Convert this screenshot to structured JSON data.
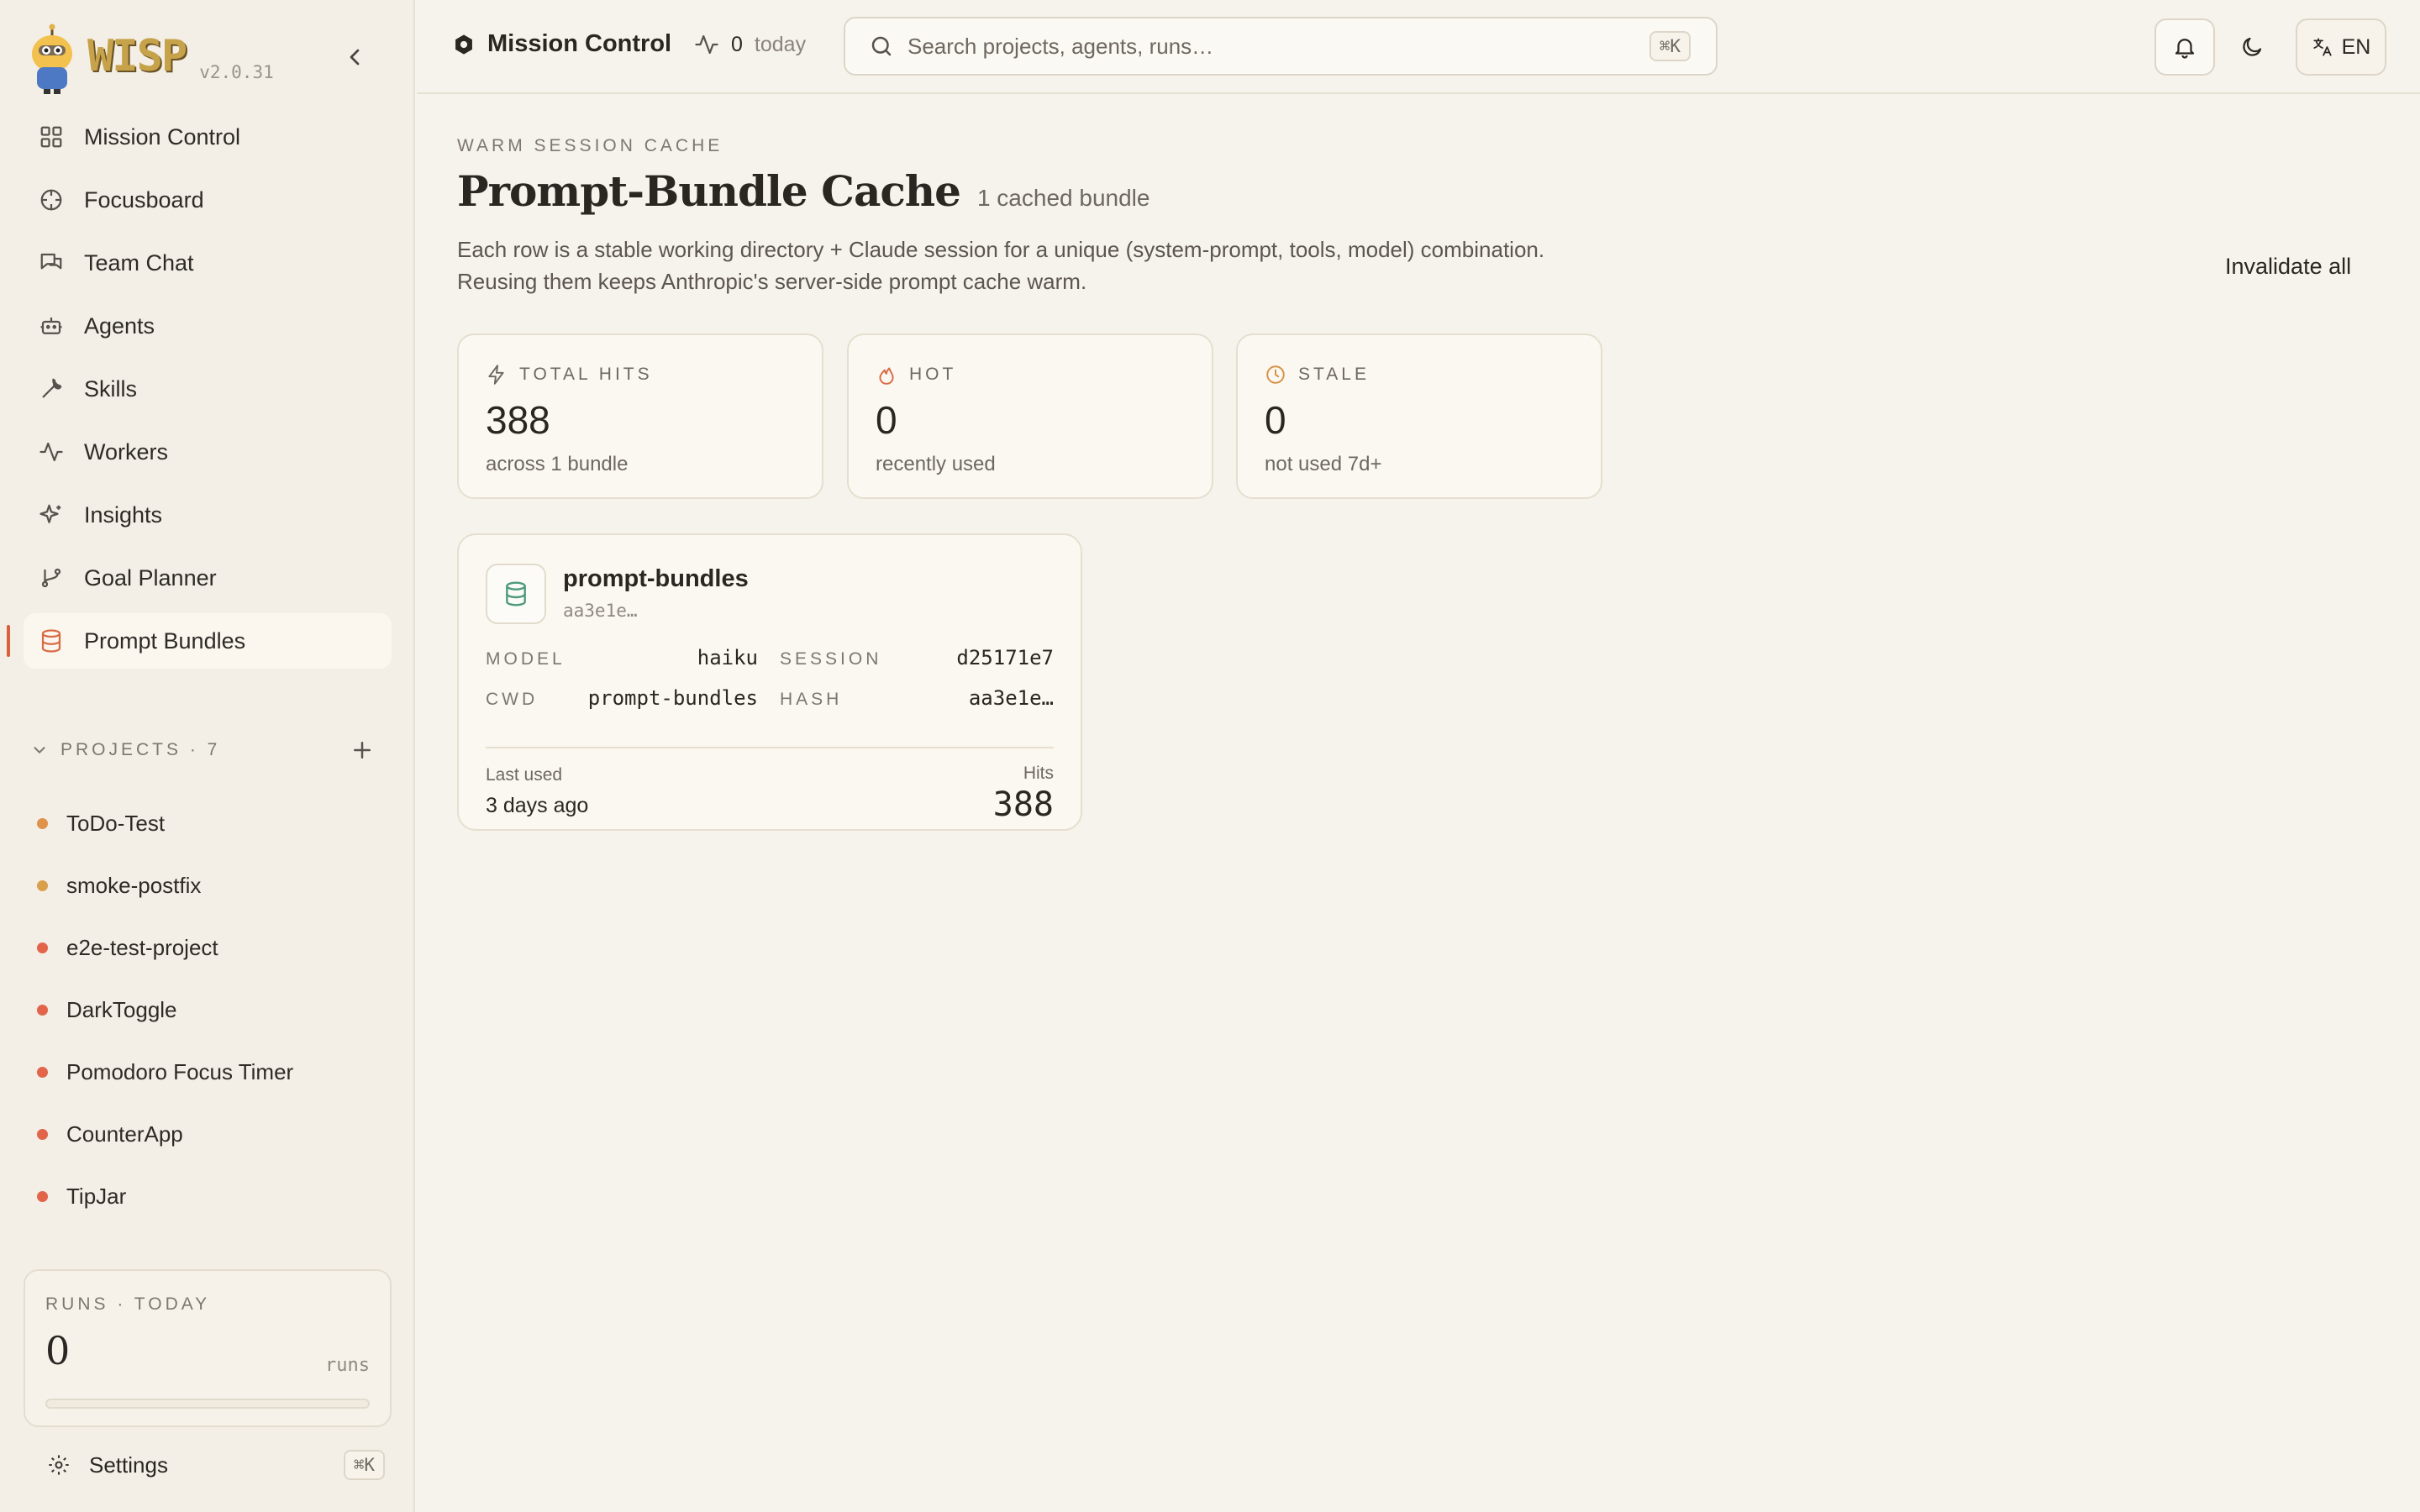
{
  "brand": {
    "name": "WISP",
    "version": "v2.0.31"
  },
  "nav": [
    {
      "label": "Mission Control",
      "icon": "grid-icon"
    },
    {
      "label": "Focusboard",
      "icon": "crosshair-icon"
    },
    {
      "label": "Team Chat",
      "icon": "chat-icon"
    },
    {
      "label": "Agents",
      "icon": "robot-icon"
    },
    {
      "label": "Skills",
      "icon": "wrench-icon"
    },
    {
      "label": "Workers",
      "icon": "activity-icon"
    },
    {
      "label": "Insights",
      "icon": "sparkles-icon"
    },
    {
      "label": "Goal Planner",
      "icon": "git-branch-icon"
    },
    {
      "label": "Prompt Bundles",
      "icon": "database-icon",
      "active": true
    }
  ],
  "projects": {
    "label": "PROJECTS · 7",
    "items": [
      {
        "name": "ToDo-Test",
        "color": "#e0914a"
      },
      {
        "name": "smoke-postfix",
        "color": "#d9a04c"
      },
      {
        "name": "e2e-test-project",
        "color": "#e2654a"
      },
      {
        "name": "DarkToggle",
        "color": "#e2654a"
      },
      {
        "name": "Pomodoro Focus Timer",
        "color": "#e2654a"
      },
      {
        "name": "CounterApp",
        "color": "#e2654a"
      },
      {
        "name": "TipJar",
        "color": "#e2654a"
      }
    ]
  },
  "runs": {
    "label": "RUNS · TODAY",
    "count": "0",
    "unit": "runs",
    "progress": 0
  },
  "settings": {
    "label": "Settings",
    "shortcut": "⌘K"
  },
  "topbar": {
    "title": "Mission Control",
    "activity_count": "0",
    "activity_label": "today",
    "search_placeholder": "Search projects, agents, runs…",
    "search_shortcut": "⌘K",
    "lang": "EN"
  },
  "page": {
    "eyebrow": "WARM SESSION CACHE",
    "title": "Prompt-Bundle Cache",
    "count": "1 cached bundle",
    "desc_line1": "Each row is a stable working directory + Claude session for a unique (system-prompt, tools, model) combination.",
    "desc_line2": "Reusing them keeps Anthropic's server-side prompt cache warm.",
    "invalidate": "Invalidate all"
  },
  "stats": [
    {
      "label": "TOTAL HITS",
      "value": "388",
      "sub": "across 1 bundle",
      "icon": "bolt-icon",
      "color": "#6e685f"
    },
    {
      "label": "HOT",
      "value": "0",
      "sub": "recently used",
      "icon": "flame-icon",
      "color": "#d86b45"
    },
    {
      "label": "STALE",
      "value": "0",
      "sub": "not used 7d+",
      "icon": "clock-icon",
      "color": "#d89045"
    }
  ],
  "bundle": {
    "name": "prompt-bundles",
    "hash_short": "aa3e1e…",
    "model_label": "MODEL",
    "model": "haiku",
    "session_label": "SESSION",
    "session": "d25171e7",
    "cwd_label": "CWD",
    "cwd": "prompt-bundles",
    "hash_label": "HASH",
    "hash": "aa3e1e…",
    "last_used_label": "Last used",
    "last_used": "3 days ago",
    "hits_label": "Hits",
    "hits": "388"
  }
}
